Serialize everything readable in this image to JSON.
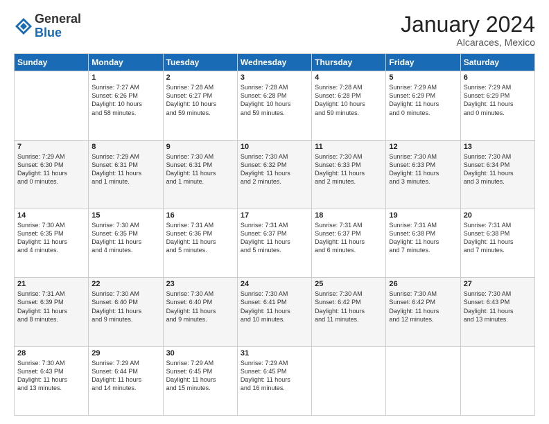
{
  "logo": {
    "general": "General",
    "blue": "Blue"
  },
  "title": "January 2024",
  "location": "Alcaraces, Mexico",
  "days_header": [
    "Sunday",
    "Monday",
    "Tuesday",
    "Wednesday",
    "Thursday",
    "Friday",
    "Saturday"
  ],
  "weeks": [
    [
      {
        "day": "",
        "info": ""
      },
      {
        "day": "1",
        "info": "Sunrise: 7:27 AM\nSunset: 6:26 PM\nDaylight: 10 hours\nand 58 minutes."
      },
      {
        "day": "2",
        "info": "Sunrise: 7:28 AM\nSunset: 6:27 PM\nDaylight: 10 hours\nand 59 minutes."
      },
      {
        "day": "3",
        "info": "Sunrise: 7:28 AM\nSunset: 6:28 PM\nDaylight: 10 hours\nand 59 minutes."
      },
      {
        "day": "4",
        "info": "Sunrise: 7:28 AM\nSunset: 6:28 PM\nDaylight: 10 hours\nand 59 minutes."
      },
      {
        "day": "5",
        "info": "Sunrise: 7:29 AM\nSunset: 6:29 PM\nDaylight: 11 hours\nand 0 minutes."
      },
      {
        "day": "6",
        "info": "Sunrise: 7:29 AM\nSunset: 6:29 PM\nDaylight: 11 hours\nand 0 minutes."
      }
    ],
    [
      {
        "day": "7",
        "info": "Sunrise: 7:29 AM\nSunset: 6:30 PM\nDaylight: 11 hours\nand 0 minutes."
      },
      {
        "day": "8",
        "info": "Sunrise: 7:29 AM\nSunset: 6:31 PM\nDaylight: 11 hours\nand 1 minute."
      },
      {
        "day": "9",
        "info": "Sunrise: 7:30 AM\nSunset: 6:31 PM\nDaylight: 11 hours\nand 1 minute."
      },
      {
        "day": "10",
        "info": "Sunrise: 7:30 AM\nSunset: 6:32 PM\nDaylight: 11 hours\nand 2 minutes."
      },
      {
        "day": "11",
        "info": "Sunrise: 7:30 AM\nSunset: 6:33 PM\nDaylight: 11 hours\nand 2 minutes."
      },
      {
        "day": "12",
        "info": "Sunrise: 7:30 AM\nSunset: 6:33 PM\nDaylight: 11 hours\nand 3 minutes."
      },
      {
        "day": "13",
        "info": "Sunrise: 7:30 AM\nSunset: 6:34 PM\nDaylight: 11 hours\nand 3 minutes."
      }
    ],
    [
      {
        "day": "14",
        "info": "Sunrise: 7:30 AM\nSunset: 6:35 PM\nDaylight: 11 hours\nand 4 minutes."
      },
      {
        "day": "15",
        "info": "Sunrise: 7:30 AM\nSunset: 6:35 PM\nDaylight: 11 hours\nand 4 minutes."
      },
      {
        "day": "16",
        "info": "Sunrise: 7:31 AM\nSunset: 6:36 PM\nDaylight: 11 hours\nand 5 minutes."
      },
      {
        "day": "17",
        "info": "Sunrise: 7:31 AM\nSunset: 6:37 PM\nDaylight: 11 hours\nand 5 minutes."
      },
      {
        "day": "18",
        "info": "Sunrise: 7:31 AM\nSunset: 6:37 PM\nDaylight: 11 hours\nand 6 minutes."
      },
      {
        "day": "19",
        "info": "Sunrise: 7:31 AM\nSunset: 6:38 PM\nDaylight: 11 hours\nand 7 minutes."
      },
      {
        "day": "20",
        "info": "Sunrise: 7:31 AM\nSunset: 6:38 PM\nDaylight: 11 hours\nand 7 minutes."
      }
    ],
    [
      {
        "day": "21",
        "info": "Sunrise: 7:31 AM\nSunset: 6:39 PM\nDaylight: 11 hours\nand 8 minutes."
      },
      {
        "day": "22",
        "info": "Sunrise: 7:30 AM\nSunset: 6:40 PM\nDaylight: 11 hours\nand 9 minutes."
      },
      {
        "day": "23",
        "info": "Sunrise: 7:30 AM\nSunset: 6:40 PM\nDaylight: 11 hours\nand 9 minutes."
      },
      {
        "day": "24",
        "info": "Sunrise: 7:30 AM\nSunset: 6:41 PM\nDaylight: 11 hours\nand 10 minutes."
      },
      {
        "day": "25",
        "info": "Sunrise: 7:30 AM\nSunset: 6:42 PM\nDaylight: 11 hours\nand 11 minutes."
      },
      {
        "day": "26",
        "info": "Sunrise: 7:30 AM\nSunset: 6:42 PM\nDaylight: 11 hours\nand 12 minutes."
      },
      {
        "day": "27",
        "info": "Sunrise: 7:30 AM\nSunset: 6:43 PM\nDaylight: 11 hours\nand 13 minutes."
      }
    ],
    [
      {
        "day": "28",
        "info": "Sunrise: 7:30 AM\nSunset: 6:43 PM\nDaylight: 11 hours\nand 13 minutes."
      },
      {
        "day": "29",
        "info": "Sunrise: 7:29 AM\nSunset: 6:44 PM\nDaylight: 11 hours\nand 14 minutes."
      },
      {
        "day": "30",
        "info": "Sunrise: 7:29 AM\nSunset: 6:45 PM\nDaylight: 11 hours\nand 15 minutes."
      },
      {
        "day": "31",
        "info": "Sunrise: 7:29 AM\nSunset: 6:45 PM\nDaylight: 11 hours\nand 16 minutes."
      },
      {
        "day": "",
        "info": ""
      },
      {
        "day": "",
        "info": ""
      },
      {
        "day": "",
        "info": ""
      }
    ]
  ]
}
